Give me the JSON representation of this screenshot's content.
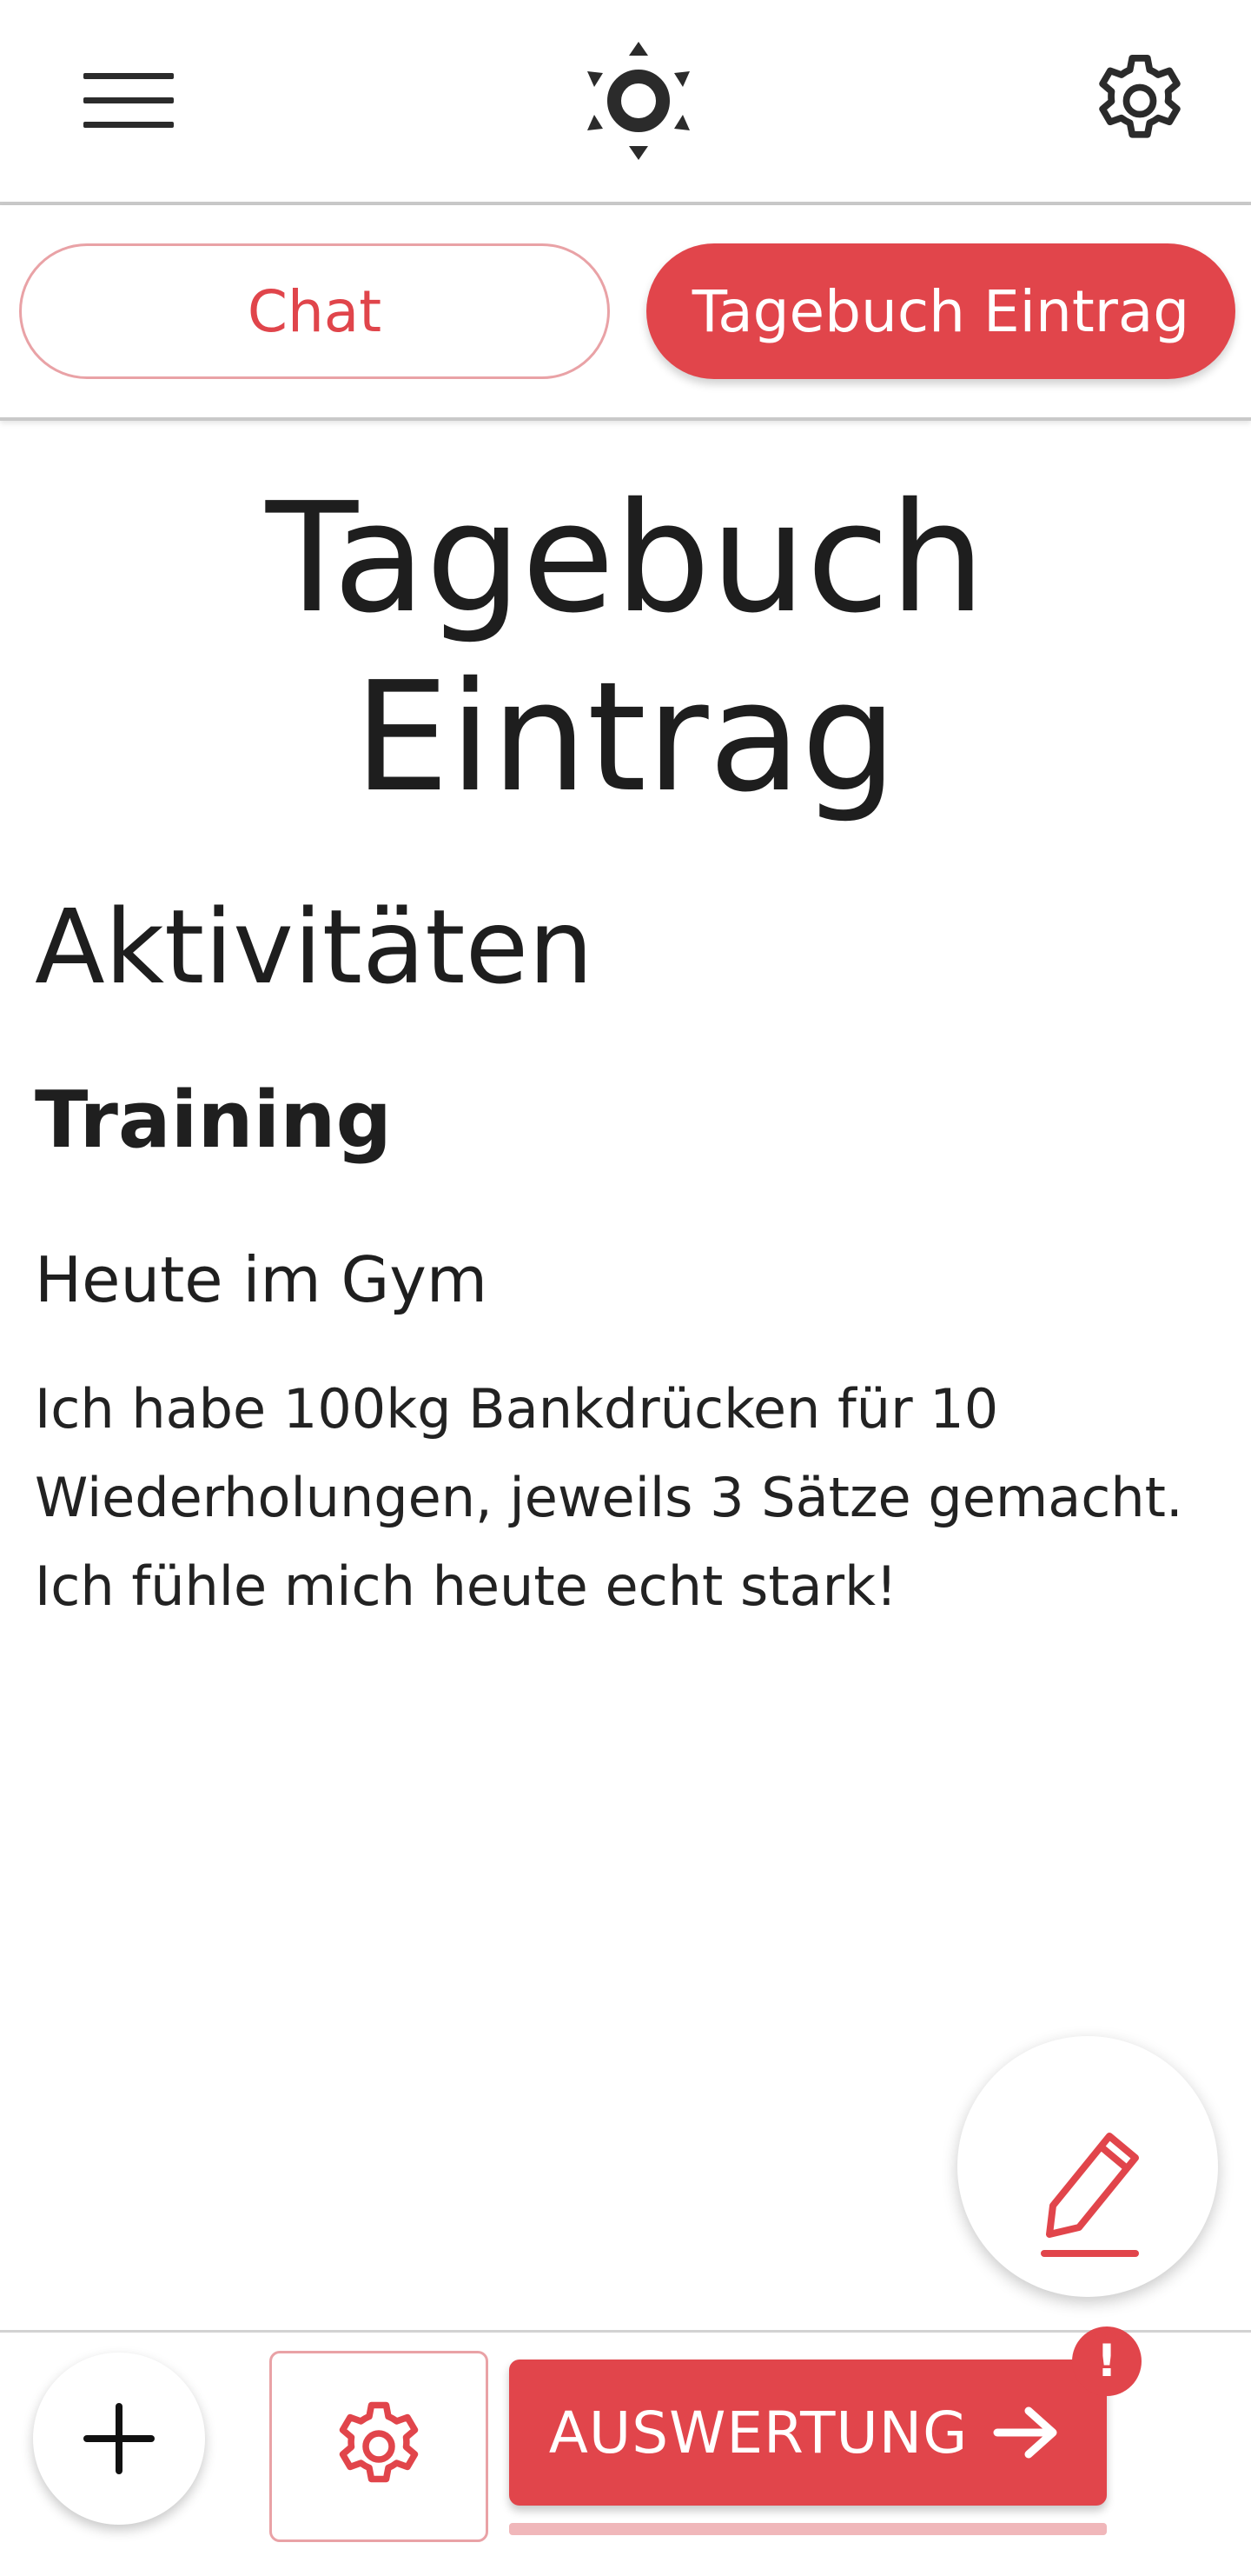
{
  "header": {
    "menu_icon": "hamburger-menu-icon",
    "logo_icon": "sun-logo-icon",
    "settings_icon": "gear-icon"
  },
  "tabs": [
    {
      "label": "Chat",
      "selected": false
    },
    {
      "label": "Tagebuch Eintrag",
      "selected": true
    }
  ],
  "content": {
    "page_title": "Tagebuch Eintrag",
    "section_title": "Aktivitäten",
    "subsection_title": "Training",
    "entry_title": "Heute im Gym",
    "entry_text": "Ich habe 100kg Bankdrücken für 10 Wiederholungen, jeweils 3 Sätze gemacht. Ich fühle mich heute echt stark!"
  },
  "fab": {
    "icon": "pencil-icon"
  },
  "bottom_bar": {
    "add_icon": "plus-icon",
    "settings_icon": "gear-icon",
    "evaluate_label": "AUSWERTUNG",
    "evaluate_icon": "arrow-right-icon",
    "alert_badge": "!"
  },
  "colors": {
    "accent": "#e1454b",
    "accent_light": "#e9a2a6",
    "text": "#1f1f1f"
  }
}
